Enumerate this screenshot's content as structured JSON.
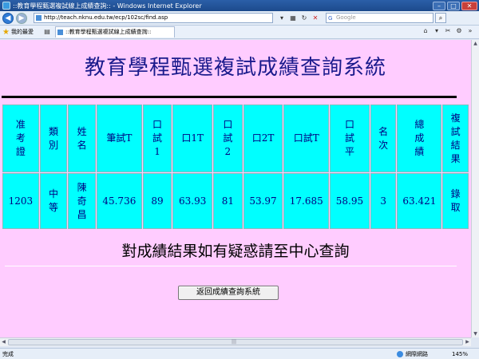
{
  "window": {
    "title": "::教育學程甄選複試線上成績查詢:: - Windows Internet Explorer",
    "minimize": "–",
    "maximize": "□",
    "close": "✕"
  },
  "address_bar": {
    "url": "http://teach.nknu.edu.tw/ecp/102sc/find.asp",
    "search_placeholder": "Google"
  },
  "favorites": {
    "label": "我的最愛",
    "tab_title": "::教育學程甄選複試線上成績查詢::"
  },
  "page": {
    "title": "教育學程甄選複試成績查詢系統",
    "headers": [
      "准考證",
      "類別",
      "姓名",
      "筆試T",
      "口試1",
      "口1T",
      "口試2",
      "口2T",
      "口試T",
      "口試平",
      "名次",
      "總成績",
      "複試結果"
    ],
    "row": [
      "1203",
      "中等",
      "陳奇昌",
      "45.736",
      "89",
      "63.93",
      "81",
      "53.97",
      "17.685",
      "58.95",
      "3",
      "63.421",
      "錄取"
    ],
    "notice": "對成績結果如有疑惑請至中心查詢",
    "return_button": "返回成績查詢系統"
  },
  "status_bar": {
    "status": "完成",
    "zone": "網際網路",
    "zoom": "145%"
  },
  "colors": {
    "page_bg": "#ffccff",
    "table_cell": "#00ffff",
    "title_text": "#1a1a8c"
  }
}
